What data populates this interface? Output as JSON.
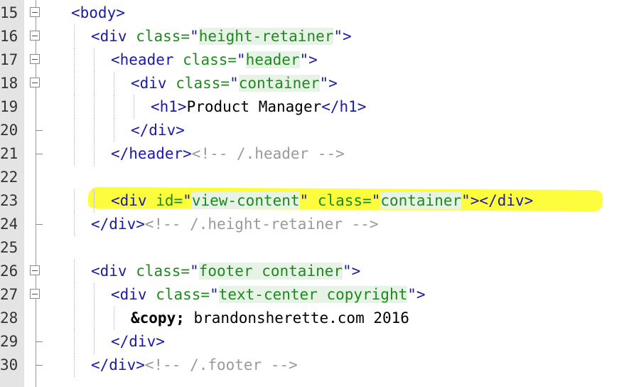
{
  "editor": {
    "lines": [
      {
        "num": "15",
        "fold": "box",
        "parts": [
          {
            "t": "<body>",
            "c": "tag"
          }
        ]
      },
      {
        "num": "16",
        "fold": "box",
        "parts": [
          {
            "t": "<div ",
            "c": "tag"
          },
          {
            "t": "class=",
            "c": "attr"
          },
          {
            "t": "\"",
            "c": "tag"
          },
          {
            "t": "height-retainer",
            "c": "attr hl"
          },
          {
            "t": "\">",
            "c": "tag"
          }
        ]
      },
      {
        "num": "17",
        "fold": "box",
        "parts": [
          {
            "t": "<header ",
            "c": "tag"
          },
          {
            "t": "class=",
            "c": "attr"
          },
          {
            "t": "\"",
            "c": "tag"
          },
          {
            "t": "header",
            "c": "attr hl"
          },
          {
            "t": "\">",
            "c": "tag"
          }
        ]
      },
      {
        "num": "18",
        "fold": "box",
        "parts": [
          {
            "t": "<div ",
            "c": "tag"
          },
          {
            "t": "class=",
            "c": "attr"
          },
          {
            "t": "\"",
            "c": "tag"
          },
          {
            "t": "container",
            "c": "attr hl"
          },
          {
            "t": "\">",
            "c": "tag"
          }
        ]
      },
      {
        "num": "19",
        "fold": "line",
        "parts": [
          {
            "t": "<h1>",
            "c": "tag"
          },
          {
            "t": "Product Manager",
            "c": "txt"
          },
          {
            "t": "</h1>",
            "c": "tag"
          }
        ]
      },
      {
        "num": "20",
        "fold": "end",
        "parts": [
          {
            "t": "</div>",
            "c": "tag"
          }
        ]
      },
      {
        "num": "21",
        "fold": "end",
        "parts": [
          {
            "t": "</header>",
            "c": "tag"
          },
          {
            "t": "<!-- /.header -->",
            "c": "comment"
          }
        ]
      },
      {
        "num": "22",
        "fold": "line",
        "parts": []
      },
      {
        "num": "23",
        "fold": "line",
        "parts": [
          {
            "t": "<div ",
            "c": "tag"
          },
          {
            "t": "id=",
            "c": "attr"
          },
          {
            "t": "\"",
            "c": "tag"
          },
          {
            "t": "view-content",
            "c": "attr hl"
          },
          {
            "t": "\" ",
            "c": "tag"
          },
          {
            "t": "class=",
            "c": "attr"
          },
          {
            "t": "\"",
            "c": "tag"
          },
          {
            "t": "container",
            "c": "attr hl"
          },
          {
            "t": "\"></div>",
            "c": "tag"
          }
        ]
      },
      {
        "num": "24",
        "fold": "end",
        "parts": [
          {
            "t": "</div>",
            "c": "tag"
          },
          {
            "t": "<!-- /.height-retainer -->",
            "c": "comment"
          }
        ]
      },
      {
        "num": "25",
        "fold": "line",
        "parts": []
      },
      {
        "num": "26",
        "fold": "box",
        "parts": [
          {
            "t": "<div ",
            "c": "tag"
          },
          {
            "t": "class=",
            "c": "attr"
          },
          {
            "t": "\"",
            "c": "tag"
          },
          {
            "t": "footer container",
            "c": "attr hl"
          },
          {
            "t": "\">",
            "c": "tag"
          }
        ]
      },
      {
        "num": "27",
        "fold": "box",
        "parts": [
          {
            "t": "<div ",
            "c": "tag"
          },
          {
            "t": "class=",
            "c": "attr"
          },
          {
            "t": "\"",
            "c": "tag"
          },
          {
            "t": "text-center copyright",
            "c": "attr hl"
          },
          {
            "t": "\">",
            "c": "tag"
          }
        ]
      },
      {
        "num": "28",
        "fold": "line",
        "parts": [
          {
            "t": "&copy;",
            "c": "ent"
          },
          {
            "t": " brandonsherette.com 2016",
            "c": "txt"
          }
        ]
      },
      {
        "num": "29",
        "fold": "end",
        "parts": [
          {
            "t": "</div>",
            "c": "tag"
          }
        ]
      },
      {
        "num": "30",
        "fold": "end",
        "parts": [
          {
            "t": "</div>",
            "c": "tag"
          },
          {
            "t": "<!-- /.footer -->",
            "c": "comment"
          }
        ]
      }
    ]
  }
}
